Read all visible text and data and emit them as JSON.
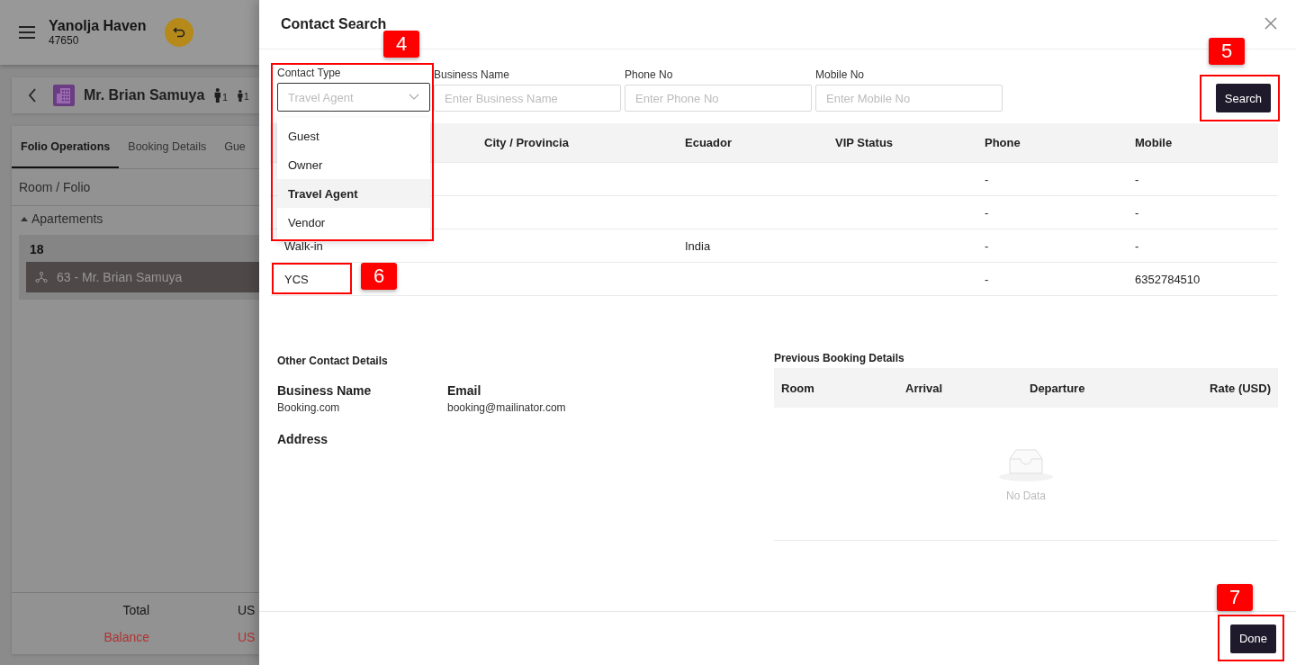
{
  "background_app": {
    "header": {
      "title": "Yanolja Haven",
      "code": "47650"
    },
    "guest": {
      "name": "Mr. Brian Samuya",
      "adults": "1",
      "children": "1"
    },
    "tabs": [
      {
        "label": "Folio Operations",
        "selected": true
      },
      {
        "label": "Booking Details",
        "selected": false
      },
      {
        "label": "Gue",
        "selected": false
      }
    ],
    "section_label": "Room / Folio",
    "group": {
      "label": "Apartements",
      "expanded": true,
      "rooms": [
        {
          "number": "18",
          "folios": [
            {
              "label": "63 - Mr. Brian Samuya",
              "selected": true
            }
          ]
        }
      ]
    },
    "totals": [
      {
        "label": "Total",
        "value": "US",
        "kind": "normal"
      },
      {
        "label": "Balance",
        "value": "US",
        "kind": "alert"
      }
    ]
  },
  "dialog": {
    "title": "Contact Search",
    "fields": [
      {
        "kind": "select",
        "label": "Contact Type",
        "value": "Travel Agent",
        "open": true
      },
      {
        "kind": "text",
        "label": "Business Name",
        "placeholder": "Enter Business Name"
      },
      {
        "kind": "text",
        "label": "Phone No",
        "placeholder": "Enter Phone No"
      },
      {
        "kind": "text",
        "label": "Mobile No",
        "placeholder": "Enter Mobile No"
      }
    ],
    "search_button": "Search",
    "dropdown_options": [
      {
        "label": "Guest",
        "selected": false
      },
      {
        "label": "Owner",
        "selected": false
      },
      {
        "label": "Travel Agent",
        "selected": true
      },
      {
        "label": "Vendor",
        "selected": false
      }
    ],
    "table": {
      "columns": [
        "City / Provincia",
        "Ecuador",
        "VIP Status",
        "Phone",
        "Mobile"
      ],
      "rows": [
        {
          "phone": "-",
          "mobile": "-"
        },
        {
          "phone": "-",
          "mobile": "-"
        },
        {
          "column_1": "Walk-in",
          "ecuador": "India",
          "phone": "-",
          "mobile": "-"
        },
        {
          "column_1": "YCS",
          "phone": "-",
          "mobile": "6352784510"
        }
      ]
    },
    "other_contact": {
      "title": "Other Contact Details",
      "fields": [
        {
          "label": "Business Name",
          "value": "Booking.com"
        },
        {
          "label": "Email",
          "value": "booking@mailinator.com"
        }
      ],
      "address_label": "Address"
    },
    "previous_bookings": {
      "title": "Previous Booking Details",
      "columns": [
        "Room",
        "Arrival",
        "Departure",
        "Rate (USD)"
      ],
      "empty_text": "No Data"
    },
    "done_button": "Done"
  },
  "annotations": [
    {
      "number": "4"
    },
    {
      "number": "5"
    },
    {
      "number": "6"
    },
    {
      "number": "7"
    }
  ]
}
